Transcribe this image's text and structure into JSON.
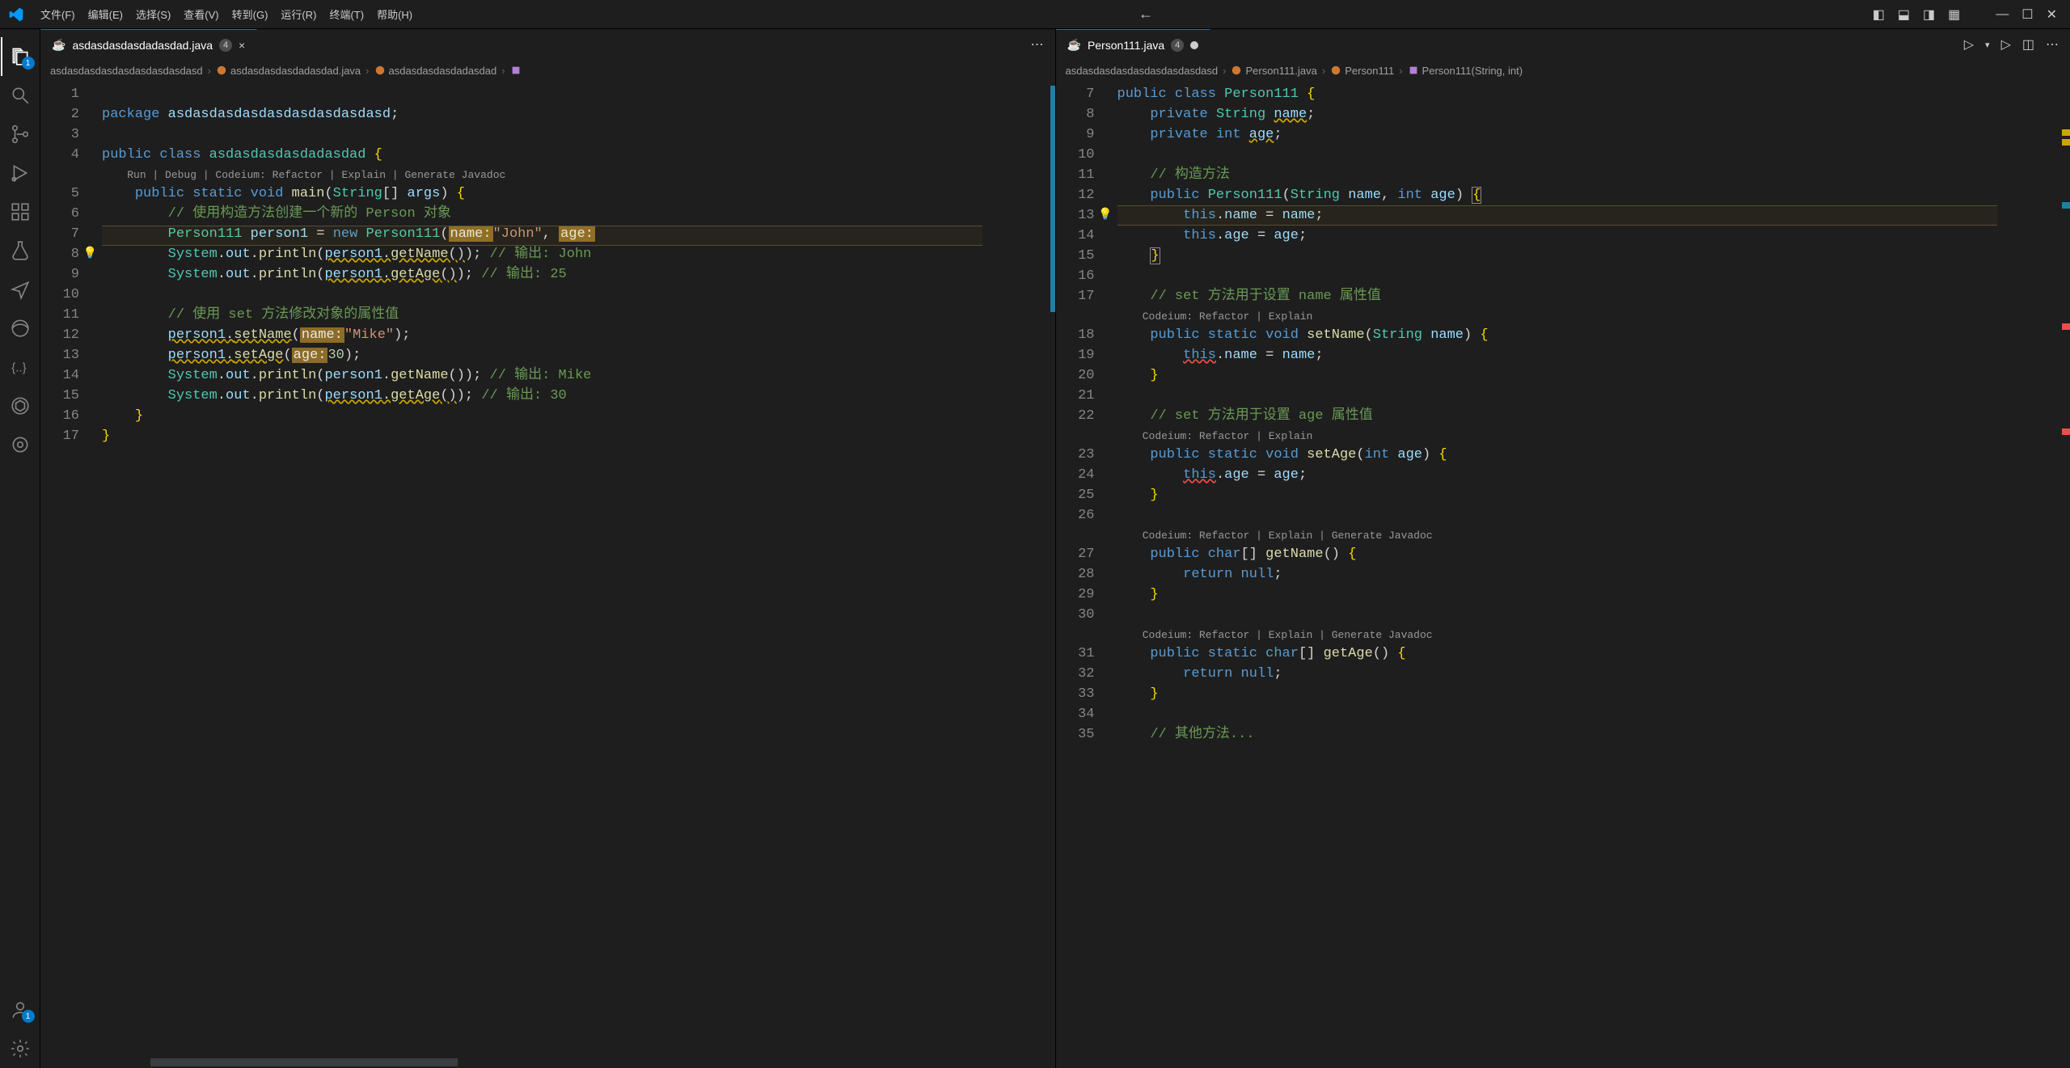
{
  "menu": [
    "文件(F)",
    "编辑(E)",
    "选择(S)",
    "查看(V)",
    "转到(G)",
    "运行(R)",
    "终端(T)",
    "帮助(H)"
  ],
  "activity": {
    "explorer_badge": "1",
    "account_badge": "1"
  },
  "left_pane": {
    "tab": {
      "name": "asdasdasdasdadasdad.java",
      "count": "4",
      "dirty": false,
      "close": true
    },
    "breadcrumb": [
      "asdasdasdasdasdasdasdasdasd",
      "asdasdasdasdadasdad.java",
      "asdasdasdasdadasdad"
    ],
    "codelens1": "Run | Debug | Codeium: Refactor | Explain | Generate Javadoc",
    "lines": {
      "l1": "",
      "l2_pkg": "package",
      "l2_name": "asdasdasdasdasdasdasdasdasd",
      "l4_kw": "public class",
      "l4_name": "asdasdasdasdadasdad",
      "l5_kw": "public static void",
      "l5_mth": "main",
      "l5_arg_ty": "String",
      "l5_arg": "args",
      "l6_cmt": "// 使用构造方法创建一个新的 Person 对象",
      "l7_ty": "Person111",
      "l7_var": "person1",
      "l7_new": "new",
      "l7_ctor": "Person111",
      "l7_ph1": "name:",
      "l7_s1": "\"John\"",
      "l7_ph2": "age:",
      "l8_sys": "System",
      "l8_out": "out",
      "l8_mth": "println",
      "l8_arg": "person1.getName()",
      "l8_cmt": "// 输出: John",
      "l9_mth": "println",
      "l9_arg": "person1.getAge()",
      "l9_cmt": "// 输出: 25",
      "l11_cmt": "// 使用 set 方法修改对象的属性值",
      "l12_var": "person1",
      "l12_mth": "setName",
      "l12_ph": "name:",
      "l12_s": "\"Mike\"",
      "l13_var": "person1",
      "l13_mth": "setAge",
      "l13_ph": "age:",
      "l13_n": "30",
      "l14_arg": "person1.getName()",
      "l14_cmt": "// 输出: Mike",
      "l15_arg": "person1.getAge()",
      "l15_cmt": "// 输出: 30"
    }
  },
  "right_pane": {
    "tab": {
      "name": "Person111.java",
      "count": "4",
      "dirty": true
    },
    "breadcrumb": [
      "asdasdasdasdasdasdasdasdasd",
      "Person111.java",
      "Person111",
      "Person111(String, int)"
    ],
    "codelens_a": "Codeium: Refactor | Explain",
    "codelens_b": "Codeium: Refactor | Explain | Generate Javadoc",
    "lines": {
      "l7_kw": "public class",
      "l7_name": "Person111",
      "l8_kw": "private",
      "l8_ty": "String",
      "l8_fld": "name",
      "l9_kw": "private",
      "l9_ty": "int",
      "l9_fld": "age",
      "l11_cmt": "// 构造方法",
      "l12_kw": "public",
      "l12_name": "Person111",
      "l12_p1t": "String",
      "l12_p1": "name",
      "l12_p2t": "int",
      "l12_p2": "age",
      "l13": "this.name = name;",
      "l14": "this.age = age;",
      "l17_cmt": "// set 方法用于设置 name 属性值",
      "l18_kw": "public static void",
      "l18_mth": "setName",
      "l18_pt": "String",
      "l18_p": "name",
      "l19": "this.name = name;",
      "l22_cmt": "// set 方法用于设置 age 属性值",
      "l23_kw": "public static void",
      "l23_mth": "setAge",
      "l23_pt": "int",
      "l23_p": "age",
      "l24": "this.age = age;",
      "l27_kw": "public",
      "l27_ty": "char",
      "l27_mth": "getName",
      "l28": "return null;",
      "l31_kw": "public static",
      "l31_ty": "char",
      "l31_mth": "getAge",
      "l32": "return null;",
      "l35_cmt": "// 其他方法..."
    }
  }
}
